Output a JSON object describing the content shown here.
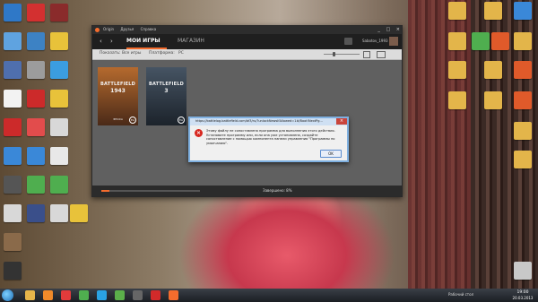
{
  "desktop": {
    "left_icons": [
      {
        "label": "",
        "color": "#2f78c7"
      },
      {
        "label": "",
        "color": "#d33030"
      },
      {
        "label": "",
        "color": "#8a2b2b"
      },
      {
        "label": "",
        "color": "#5fa3e0"
      },
      {
        "label": "",
        "color": "#3d82c4"
      },
      {
        "label": "",
        "color": "#e8c23a"
      },
      {
        "label": "",
        "color": "#4f6fae"
      },
      {
        "label": "",
        "color": "#9c9c9c"
      },
      {
        "label": "",
        "color": "#3b9de0"
      },
      {
        "label": "",
        "color": "#f2f2f2"
      },
      {
        "label": "",
        "color": "#cc2a2a"
      }
    ],
    "right_icons": [
      {
        "label": "",
        "color": "#e3b54a"
      },
      {
        "label": "",
        "color": "#e3b54a"
      },
      {
        "label": "",
        "color": "#3a88d8"
      },
      {
        "label": "",
        "color": "#e3b54a"
      },
      {
        "label": "",
        "color": "#e05a2a"
      },
      {
        "label": "",
        "color": "#e3b54a"
      },
      {
        "label": "",
        "color": "#e3b54a"
      },
      {
        "label": "",
        "color": "#e3b54a"
      }
    ]
  },
  "app": {
    "menu": [
      "Origin",
      "Друзья",
      "Справка"
    ],
    "window_buttons": [
      "_",
      "□",
      "×"
    ],
    "tabs": {
      "my_games": "МОИ ИГРЫ",
      "store": "МАГАЗИН"
    },
    "user_name": "Sabotov_1993",
    "filter": {
      "show_label": "Показать:",
      "show_value": "Все игры",
      "platform_label": "Платформа:",
      "platform_value": "PC"
    },
    "games": [
      {
        "title": "BATTLEFIELD",
        "subtitle": "1943",
        "edition": "ЭПОХА",
        "color": "#8b4a22"
      },
      {
        "title": "BATTLEFIELD",
        "subtitle": "3",
        "edition": "",
        "color": "#2b3540"
      }
    ],
    "progress": 0.08,
    "status_text": "Завершено: 8%"
  },
  "dialog": {
    "title": "https://battlelog.battlefield.com/bf3/ru/?unlockNewsIfAllowed=1#/Boot!NextPg...",
    "message": "Этому файлу не сопоставлена программа для выполнения этого действия. Установите программу или, если она уже установлена, создайте сопоставление с помощью компонента панели управления \"Программы по умолчанию\".",
    "ok_label": "OK"
  },
  "taskbar": {
    "apps": [
      {
        "name": "explorer",
        "color": "#e6b54a"
      },
      {
        "name": "media-player",
        "color": "#f08a2a"
      },
      {
        "name": "yandex",
        "color": "#e23b3b"
      },
      {
        "name": "chrome",
        "color": "#4fae4f"
      },
      {
        "name": "skype",
        "color": "#2aa3e3"
      },
      {
        "name": "utorrent",
        "color": "#5bb04a"
      },
      {
        "name": "game",
        "color": "#666666"
      },
      {
        "name": "opera",
        "color": "#d22a2a"
      },
      {
        "name": "origin",
        "color": "#f56c2d"
      }
    ],
    "tray_text": "Рабочий стол",
    "time": "19:00",
    "date": "20.03.2013"
  }
}
